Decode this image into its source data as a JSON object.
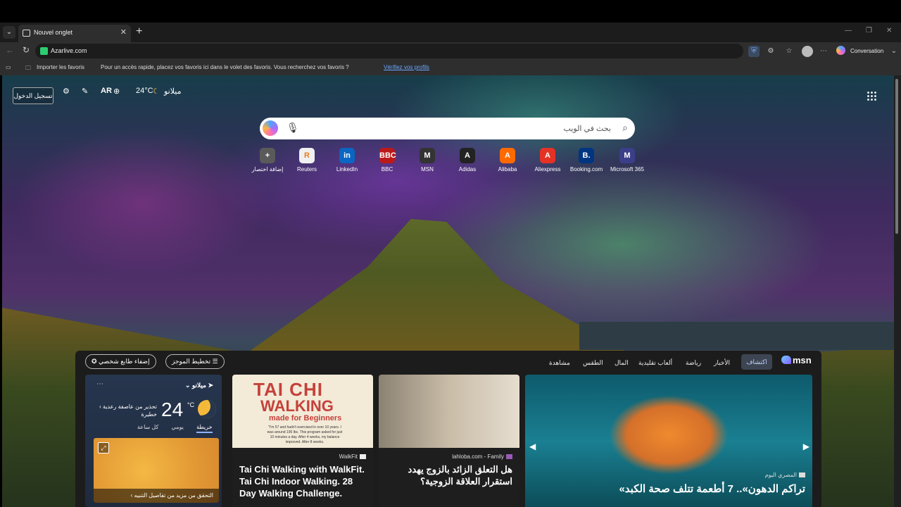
{
  "browser": {
    "tab_title": "Nouvel onglet",
    "address": "Azarlive.com",
    "conversation_label": "Conversation",
    "favbar": {
      "import_label": "Importer les favoris",
      "message": "Pour un accès rapide, placez vos favoris ici dans le volet des favoris. Vous recherchez vos favoris ?",
      "link": "Vérifiez vos profils"
    }
  },
  "newtab": {
    "signin": "تسجيل الدخول",
    "lang": "AR",
    "weather_top": {
      "temp": "24°C",
      "city": "ميلانو"
    },
    "search_placeholder": "بحث في الويب",
    "tiles": [
      {
        "label": "إضافة اختصار",
        "icon": "+",
        "color": "#5a5a5a"
      },
      {
        "label": "Reuters",
        "icon": "R",
        "color": "#f0f0f0"
      },
      {
        "label": "LinkedIn",
        "icon": "in",
        "color": "#0a66c2"
      },
      {
        "label": "BBC",
        "icon": "BBC",
        "color": "#bb1919"
      },
      {
        "label": "MSN",
        "icon": "M",
        "color": "#333333"
      },
      {
        "label": "Adidas",
        "icon": "A",
        "color": "#222222"
      },
      {
        "label": "Alibaba",
        "icon": "A",
        "color": "#ff6a00"
      },
      {
        "label": "Aliexpress",
        "icon": "A",
        "color": "#e43225"
      },
      {
        "label": "Booking.com",
        "icon": "B.",
        "color": "#003580"
      },
      {
        "label": "Microsoft 365",
        "icon": "M",
        "color": "#3b3f8a"
      }
    ]
  },
  "feed": {
    "msn": "msn",
    "nav": [
      "اكتشاف",
      "الأخبار",
      "رياضة",
      "ألعاب تقليدية",
      "المال",
      "الطقس",
      "مشاهدة"
    ],
    "customize": "تخطيط الموجز",
    "personalize": "إضفاء طابع شخصي",
    "weather": {
      "city": "ميلانو",
      "temp": "24",
      "unit": "°C",
      "alert": "تحذير من عاصفة رعدية خطيرة",
      "tabs": [
        "كل ساعة",
        "يومي",
        "خريطة"
      ],
      "map_link": "التحقق من مزيد من تفاصيل التنبيه"
    },
    "cards": [
      {
        "source": "WalkFit",
        "title": "Tai Chi Walking with WalkFit. Tai Chi Indoor Walking. 28 Day Walking Challenge.",
        "img_title1": "TAI CHI",
        "img_title2": "WALKING",
        "img_sub": "made for Beginners",
        "img_quote": "\"I'm 57 and hadn't exercised in over 10 years. I was around 195 lbs. This program asked for just 10 minutes a day. After 4 weeks, my balance improved. After 8 weeks."
      },
      {
        "source": "lahloba.com - Family",
        "title": "هل التعلق الزائد بالزوج يهدد استقرار العلاقة الزوجية؟"
      },
      {
        "source": "المصري اليوم",
        "title": "«تراكم الدهون».. 7 أطعمة تتلف صحة الكبد"
      }
    ]
  }
}
